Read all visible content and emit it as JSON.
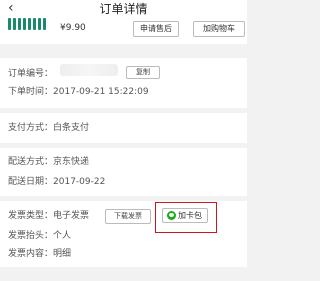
{
  "header": {
    "back_icon": "‹",
    "title": "订单详情"
  },
  "product": {
    "price": "¥9.90",
    "after_sale_label": "申请售后",
    "add_cart_label": "加购物车"
  },
  "order": {
    "number_label": "订单编号：",
    "copy_label": "复制",
    "time_label": "下单时间：",
    "time_value": "2017-09-21 15:22:09"
  },
  "payment": {
    "label": "支付方式：",
    "value": "白条支付"
  },
  "delivery": {
    "method_label": "配送方式：",
    "method_value": "京东快递",
    "date_label": "配送日期：",
    "date_value": "2017-09-22"
  },
  "invoice": {
    "type_label": "发票类型：",
    "type_value": "电子发票",
    "download_label": "下载发票",
    "card_label": "加卡包",
    "title_label": "发票抬头：",
    "title_value": "个人",
    "content_label": "发票内容：",
    "content_value": "明细"
  },
  "colors": {
    "wechat_green": "#1aad19",
    "highlight_red": "#c8171e",
    "product_green": "#1a8a6d"
  }
}
